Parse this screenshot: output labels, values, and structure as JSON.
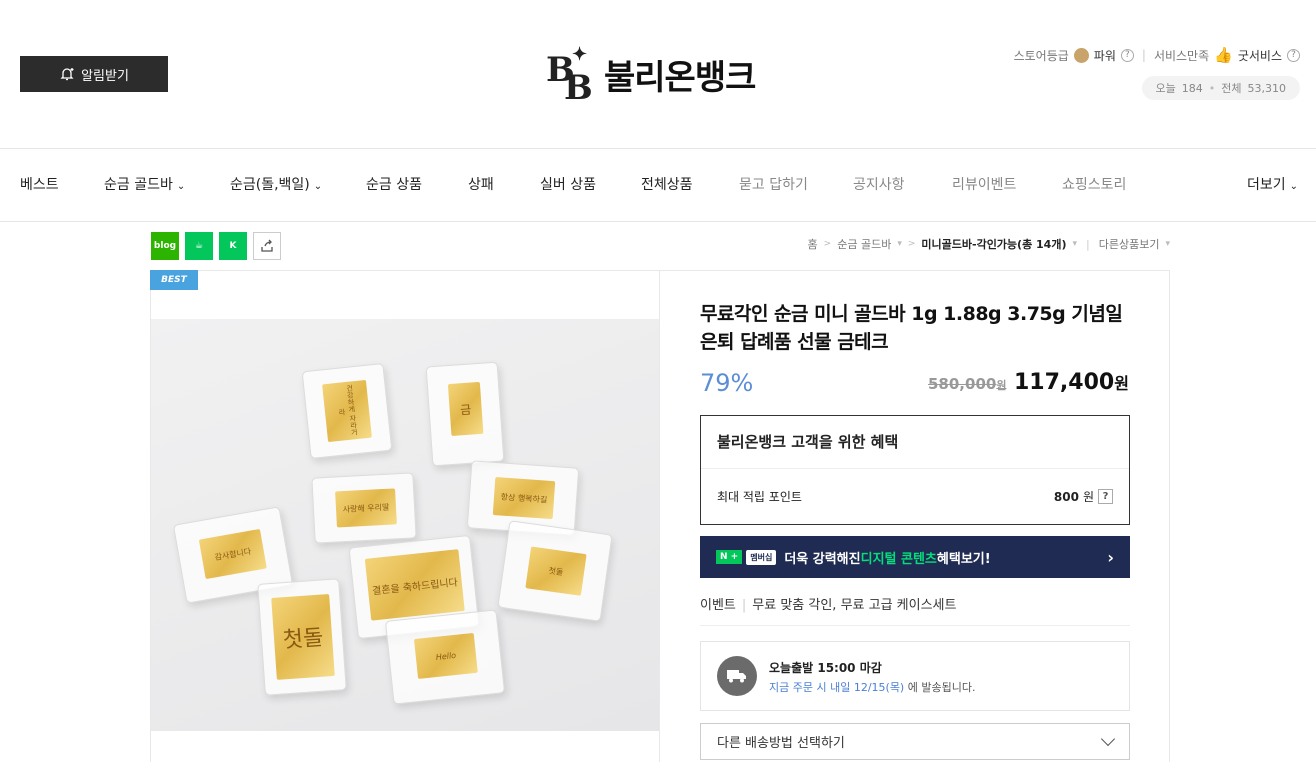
{
  "header": {
    "alarm_label": "알림받기",
    "logo_letters": "BB",
    "logo_text": "불리온뱅크",
    "store_grade_label": "스토어등급",
    "store_grade_value": "파워",
    "service_label": "서비스만족",
    "service_value": "굿서비스",
    "today_label": "오늘",
    "today_count": "184",
    "total_label": "전체",
    "total_count": "53,310"
  },
  "nav": {
    "items": [
      {
        "label": "베스트"
      },
      {
        "label": "순금 골드바"
      },
      {
        "label": "순금(돌,백일)"
      },
      {
        "label": "순금 상품"
      },
      {
        "label": "상패"
      },
      {
        "label": "실버 상품"
      },
      {
        "label": "전체상품"
      },
      {
        "label": "묻고 답하기"
      },
      {
        "label": "공지사항"
      },
      {
        "label": "리뷰이벤트"
      },
      {
        "label": "쇼핑스토리"
      }
    ],
    "more_label": "더보기"
  },
  "share": {
    "blog_label": "blog"
  },
  "breadcrumb": {
    "home": "홈",
    "level1": "순금 골드바",
    "current": "미니골드바-각인가능(총 14개)",
    "other": "다른상품보기"
  },
  "product": {
    "badge": "BEST",
    "title": "무료각인 순금 미니 골드바 1g 1.88g 3.75g 기념일 은퇴 답례품 선물 금테크",
    "discount": "79%",
    "original_price": "580,000",
    "sale_price": "117,400",
    "currency": "원",
    "image_bars": [
      {
        "text": "첫돌"
      },
      {
        "text": "금"
      },
      {
        "text": "건강하게 자라거라"
      },
      {
        "text": "사랑해 우리딸"
      },
      {
        "text": "항상 행복하길"
      },
      {
        "text": "결혼을 축하드립니다"
      },
      {
        "text": "첫돌"
      },
      {
        "text": "Hello"
      },
      {
        "text": "감사합니다"
      }
    ]
  },
  "benefit": {
    "title": "불리온뱅크 고객을 위한 혜택",
    "row_label": "최대 적립 포인트",
    "row_value": "800",
    "row_unit": "원"
  },
  "npay": {
    "n_badge": "N +",
    "membership": "멤버십",
    "text_pre": "더욱 강력해진 ",
    "text_hl": "디지털 콘텐츠",
    "text_post": " 혜택보기!"
  },
  "event": {
    "label": "이벤트",
    "text": "무료 맞춤 각인, 무료 고급 케이스세트"
  },
  "shipping": {
    "line1": "오늘출발 15:00 마감",
    "line2_blue": "지금 주문 시 내일 12/15(목)",
    "line2_rest": " 에 발송됩니다."
  },
  "select": {
    "label": "다른 배송방법 선택하기"
  },
  "colors": {
    "accent_blue": "#5c8dd7",
    "npay_bg": "#1f2b53",
    "naver_green": "#03c75a",
    "best_badge": "#49a3df"
  }
}
